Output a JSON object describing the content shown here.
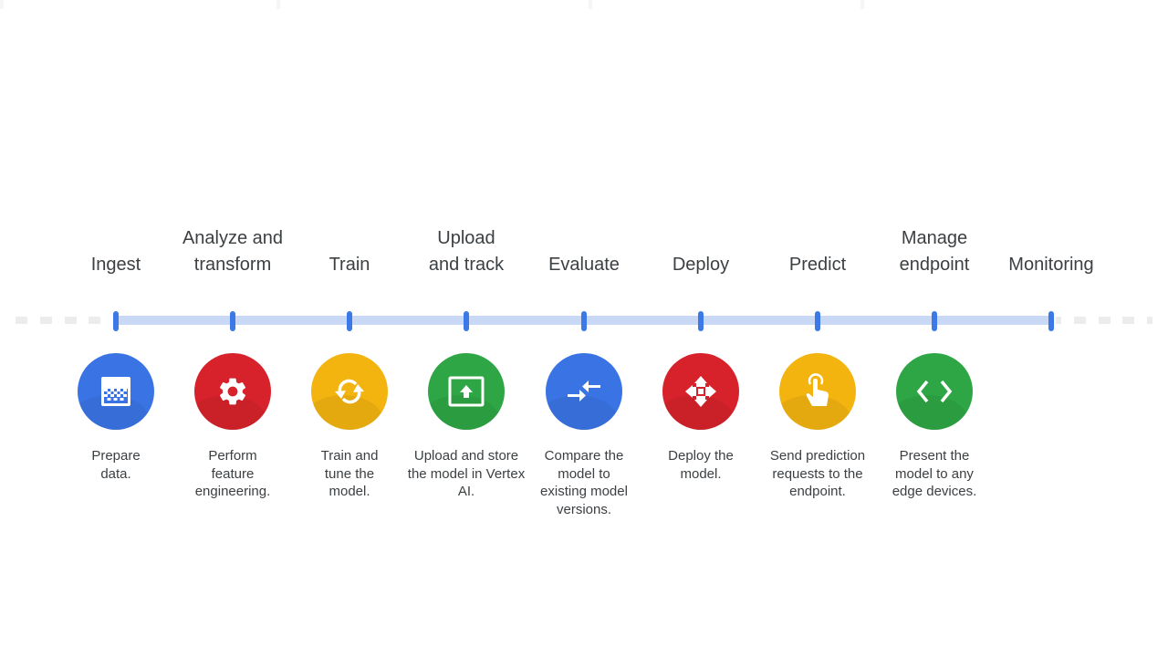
{
  "colors": {
    "blue": "#3a74e4",
    "red": "#d7222b",
    "yellow": "#f3b410",
    "green": "#2ea645",
    "track": "#c9d9f5",
    "tick": "#3c78e6",
    "text": "#3c4043"
  },
  "stages": [
    {
      "label": "Ingest"
    },
    {
      "label": "Analyze and transform"
    },
    {
      "label": "Train"
    },
    {
      "label": "Upload and track"
    },
    {
      "label": "Evaluate"
    },
    {
      "label": "Deploy"
    },
    {
      "label": "Predict"
    },
    {
      "label": "Manage endpoint"
    },
    {
      "label": "Monitoring"
    }
  ],
  "steps": [
    {
      "icon": "data-table-icon",
      "color": "blue",
      "description": "Prepare data."
    },
    {
      "icon": "gear-icon",
      "color": "red",
      "description": "Perform feature engineering."
    },
    {
      "icon": "sync-icon",
      "color": "yellow",
      "description": "Train and tune the model."
    },
    {
      "icon": "upload-icon",
      "color": "green",
      "description": "Upload and store the model in Vertex AI."
    },
    {
      "icon": "compare-arrows-icon",
      "color": "blue",
      "description": "Compare the model to existing model versions."
    },
    {
      "icon": "move-arrows-icon",
      "color": "red",
      "description": "Deploy the model."
    },
    {
      "icon": "touch-icon",
      "color": "yellow",
      "description": "Send prediction requests to the endpoint."
    },
    {
      "icon": "code-icon",
      "color": "green",
      "description": "Present the model to any edge devices."
    }
  ]
}
